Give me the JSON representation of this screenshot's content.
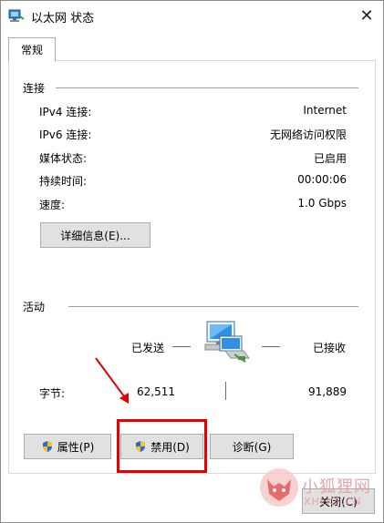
{
  "window": {
    "title": "以太网 状态",
    "close_glyph": "✕"
  },
  "tab": {
    "label": "常规"
  },
  "connection": {
    "section_title": "连接",
    "rows": [
      {
        "label": "IPv4 连接:",
        "value": "Internet"
      },
      {
        "label": "IPv6 连接:",
        "value": "无网络访问权限"
      },
      {
        "label": "媒体状态:",
        "value": "已启用"
      },
      {
        "label": "持续时间:",
        "value": "00:00:06"
      },
      {
        "label": "速度:",
        "value": "1.0 Gbps"
      }
    ],
    "details_button": "详细信息(E)..."
  },
  "activity": {
    "section_title": "活动",
    "sent_label": "已发送",
    "received_label": "已接收",
    "bytes_label": "字节:",
    "bytes_sent": "62,511",
    "bytes_received": "91,889",
    "icon": "network-computers-icon"
  },
  "buttons": {
    "properties": "属性(P)",
    "disable": "禁用(D)",
    "diagnose": "诊断(G)",
    "close": "关闭(C)"
  },
  "annotation": {
    "highlight_color": "#e60000",
    "arrow_color": "#e60000"
  },
  "watermark": {
    "text_cn": "小狐狸网",
    "text_en": "XHLKS.CN"
  }
}
